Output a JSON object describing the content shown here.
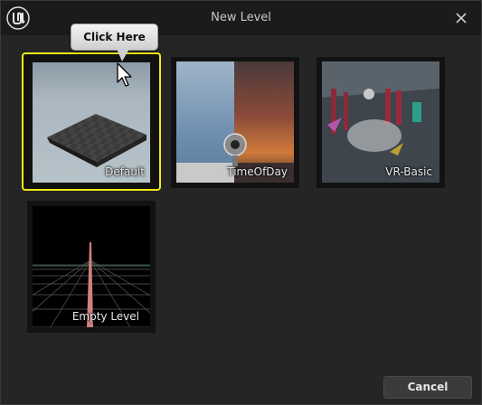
{
  "window": {
    "title": "New Level"
  },
  "tooltip": {
    "text": "Click Here"
  },
  "templates": [
    {
      "label": "Default",
      "selected": true
    },
    {
      "label": "TimeOfDay",
      "selected": false
    },
    {
      "label": "VR-Basic",
      "selected": false
    },
    {
      "label": "Empty Level",
      "selected": false
    }
  ],
  "footer": {
    "cancel_label": "Cancel"
  },
  "colors": {
    "selection": "#f2ea14",
    "background": "#252525",
    "titlebar": "#1b1b1b"
  }
}
